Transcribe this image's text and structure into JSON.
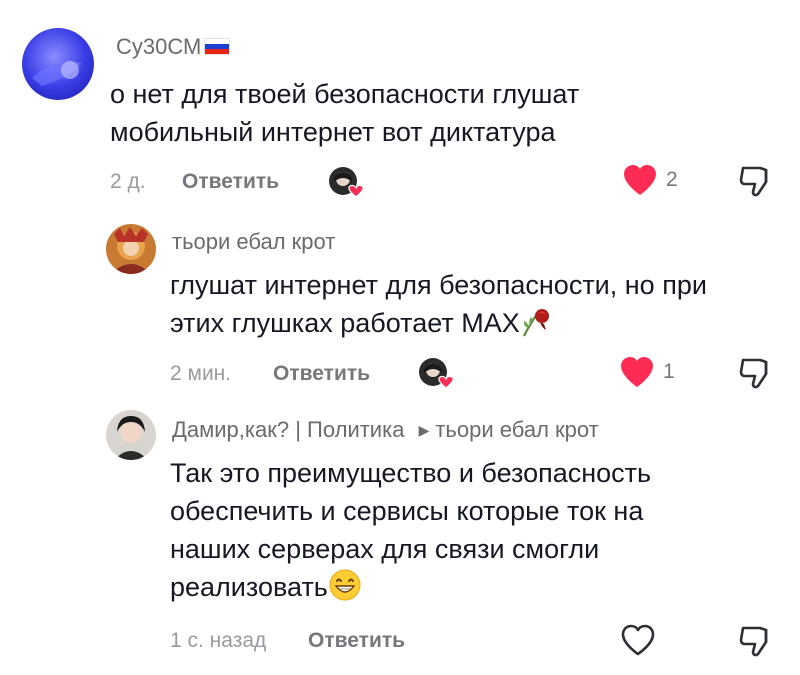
{
  "comments": [
    {
      "username": "Су30СМ",
      "text_line1": "о нет для твоей безопасности глушат",
      "text_line2": "мобильный интернет вот диктатура",
      "time": "2 д.",
      "reply_label": "Ответить",
      "likes": "2",
      "liked": true
    },
    {
      "username": "тьори ебал крот",
      "text_line1": "глушат интернет для безопасности, но при",
      "text_line2": "этих глушках работает MAX",
      "time": "2 мин.",
      "reply_label": "Ответить",
      "likes": "1",
      "liked": true
    },
    {
      "username": "Дамир,как? | Политика",
      "reply_to": "тьори ебал крот",
      "text_line1": "Так это преимущество и безопасность",
      "text_line2": "обеспечить и сервисы которые ток на",
      "text_line3": "наших серверах для связи смогли",
      "text_line4": "реализовать",
      "time": "1 с. назад",
      "reply_label": "Ответить",
      "liked": false
    }
  ],
  "icons": {
    "like_filled": "heart-filled-icon",
    "like_outline": "heart-outline-icon",
    "dislike": "thumbs-down-icon",
    "emoji_wilted": "wilted-rose-emoji",
    "emoji_smile": "grinning-face-emoji",
    "flag": "russia-flag-icon"
  },
  "colors": {
    "like_red": "#fe2c55",
    "text": "#161823",
    "muted": "#9a9aa0",
    "username": "#6b6b6f"
  }
}
